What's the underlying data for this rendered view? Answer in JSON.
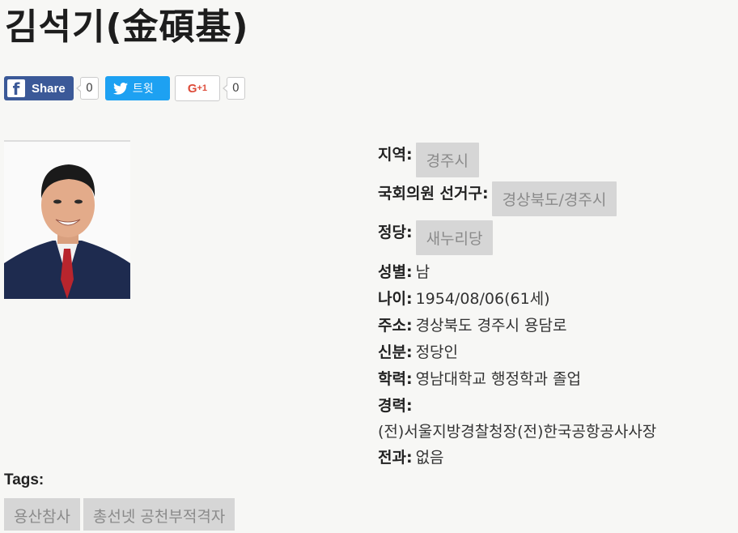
{
  "title": "김석기(金碩基)",
  "share": {
    "facebook_label": "Share",
    "facebook_count": "0",
    "twitter_label": "트윗",
    "gplus_label": "G",
    "gplus_plus": "+1",
    "gplus_count": "0"
  },
  "profile": {
    "region_label": "지역:",
    "region_value": "경주시",
    "district_label": "국회의원 선거구:",
    "district_value": "경상북도/경주시",
    "party_label": "정당:",
    "party_value": "새누리당",
    "gender_label": "성별:",
    "gender_value": "남",
    "age_label": "나이:",
    "age_value": "1954/08/06(61세)",
    "address_label": "주소:",
    "address_value": "경상북도 경주시 용담로",
    "occupation_label": "신분:",
    "occupation_value": "정당인",
    "education_label": "학력:",
    "education_value": "영남대학교 행정학과 졸업",
    "career_label": "경력:",
    "career_value": "(전)서울지방경찰청장(전)한국공항공사사장",
    "record_label": "전과:",
    "record_value": "없음"
  },
  "tags": {
    "label": "Tags:",
    "items": [
      "용산참사",
      "총선넷 공천부적격자"
    ]
  },
  "colors": {
    "facebook": "#3b5998",
    "twitter": "#1da1f2",
    "gplus": "#dd4b39",
    "chip_bg": "#d6d6d6",
    "chip_text": "#8a8a8a"
  }
}
